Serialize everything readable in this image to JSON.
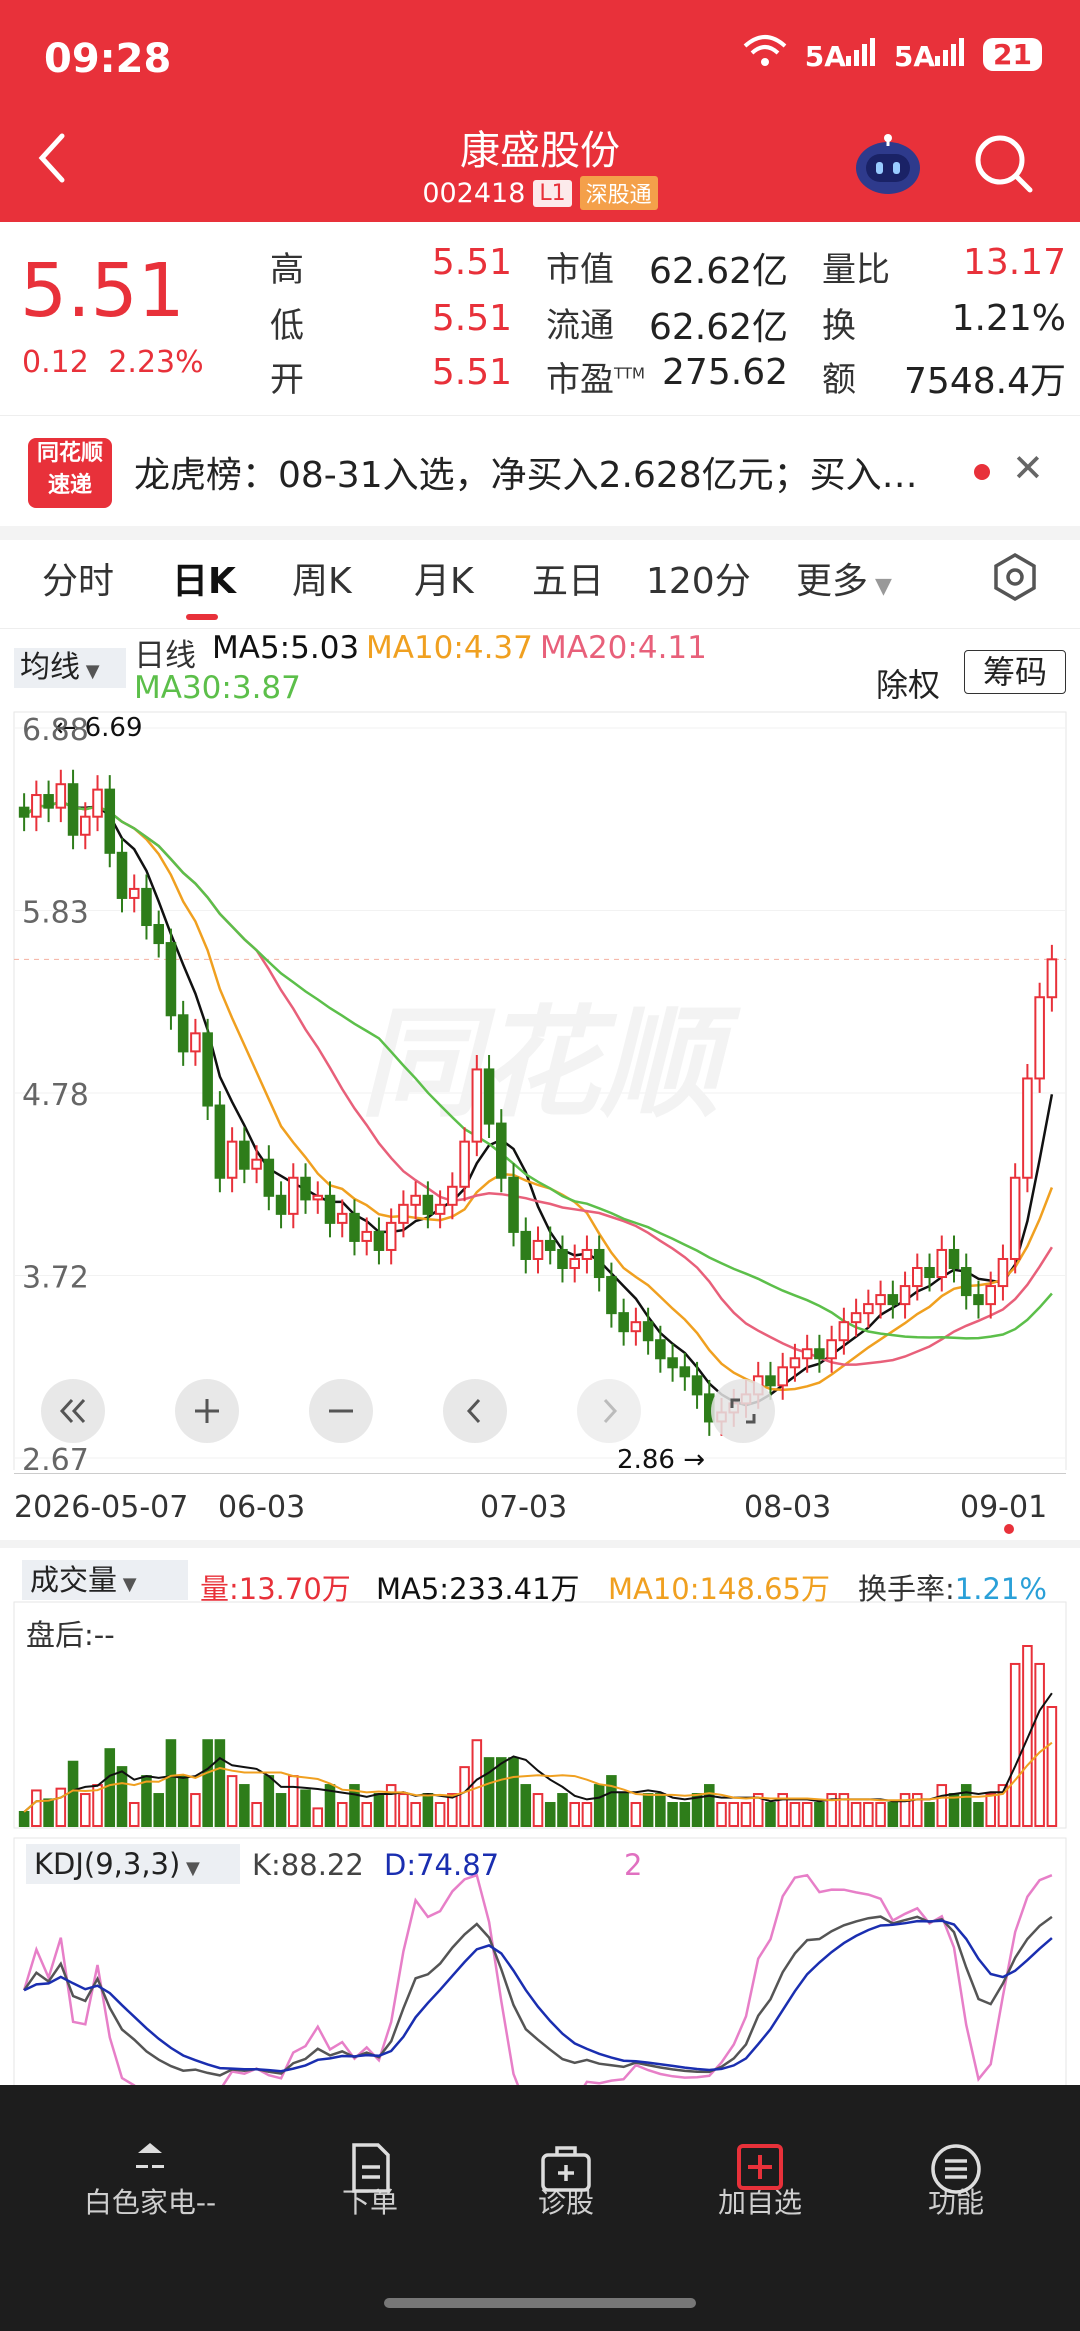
{
  "status": {
    "time": "09:28",
    "signal1": "5A",
    "signal2": "5A",
    "battery": "21"
  },
  "header": {
    "title": "康盛股份",
    "code": "002418",
    "level_tag": "L1",
    "market_tag": "深股通"
  },
  "quote": {
    "price": "5.51",
    "change": "0.12",
    "change_pct": "2.23%",
    "high_label": "高",
    "high": "5.51",
    "low_label": "低",
    "low": "5.51",
    "open_label": "开",
    "open": "5.51",
    "mcap_label": "市值",
    "mcap": "62.62亿",
    "float_label": "流通",
    "float": "62.62亿",
    "pe_label": "市盈",
    "pe_sup": "TTM",
    "pe": "275.62",
    "vr_label": "量比",
    "vr": "13.17",
    "turnover_label": "换",
    "turnover": "1.21%",
    "amount_label": "额",
    "amount": "7548.4万"
  },
  "news": {
    "logo_top": "同花顺",
    "logo_bottom": "速递",
    "text": "龙虎榜：08-31入选，净买入2.628亿元；买入…"
  },
  "tabs": [
    "分时",
    "日K",
    "周K",
    "月K",
    "五日",
    "120分",
    "更多"
  ],
  "active_tab": "日K",
  "chart_toolbar": {
    "mode": "均线",
    "period": "日线",
    "ma5": "MA5:5.03",
    "ma10": "MA10:4.37",
    "ma20": "MA20:4.11",
    "ma30": "MA30:3.87",
    "fq": "除权",
    "chip": "筹码"
  },
  "colors": {
    "up": "#e8313a",
    "down": "#2e7d1a",
    "ma5": "#111111",
    "ma10": "#f0a020",
    "ma20": "#e8607a",
    "ma30": "#5cbf4a"
  },
  "watermark": "同花顺",
  "chart_data": {
    "type": "candlestick",
    "y_ticks": [
      "6.88",
      "5.83",
      "4.78",
      "3.72",
      "2.67"
    ],
    "x_ticks": [
      "2026-05-07",
      "06-03",
      "07-03",
      "08-03",
      "09-01"
    ],
    "ylim": [
      2.67,
      6.88
    ],
    "max_label": "← 6.69",
    "min_label": "2.86 →",
    "closes": [
      6.3,
      6.42,
      6.35,
      6.48,
      6.2,
      6.3,
      6.45,
      6.1,
      5.85,
      5.9,
      5.7,
      5.6,
      5.2,
      5.0,
      5.1,
      4.7,
      4.3,
      4.5,
      4.35,
      4.4,
      4.2,
      4.1,
      4.3,
      4.18,
      4.2,
      4.05,
      4.1,
      3.95,
      4.0,
      3.9,
      4.05,
      4.15,
      4.2,
      4.1,
      4.15,
      4.25,
      4.5,
      4.9,
      4.6,
      4.3,
      4.0,
      3.85,
      3.95,
      3.9,
      3.8,
      3.85,
      3.9,
      3.75,
      3.55,
      3.45,
      3.5,
      3.4,
      3.3,
      3.25,
      3.2,
      3.1,
      2.95,
      3.0,
      3.05,
      3.1,
      3.2,
      3.15,
      3.25,
      3.3,
      3.35,
      3.3,
      3.4,
      3.5,
      3.55,
      3.6,
      3.65,
      3.6,
      3.7,
      3.8,
      3.75,
      3.9,
      3.8,
      3.65,
      3.6,
      3.7,
      3.85,
      4.3,
      4.85,
      5.3,
      5.51
    ]
  },
  "volume": {
    "mode": "成交量",
    "vol": "量:13.70万",
    "ma5": "MA5:233.41万",
    "ma10": "MA10:148.65万",
    "turnover_label": "换手率:",
    "turnover": "1.21%",
    "after_hours": "盘后:--"
  },
  "kdj": {
    "mode": "KDJ(9,3,3)",
    "k": "K:88.22",
    "d": "D:74.87",
    "j": "2"
  },
  "nav": {
    "items": [
      {
        "label": "白色家电--",
        "icon": "sector-icon"
      },
      {
        "label": "下单",
        "icon": "order-icon"
      },
      {
        "label": "诊股",
        "icon": "diagnose-icon"
      },
      {
        "label": "加自选",
        "icon": "add-watchlist-icon"
      },
      {
        "label": "功能",
        "icon": "menu-icon"
      }
    ]
  }
}
